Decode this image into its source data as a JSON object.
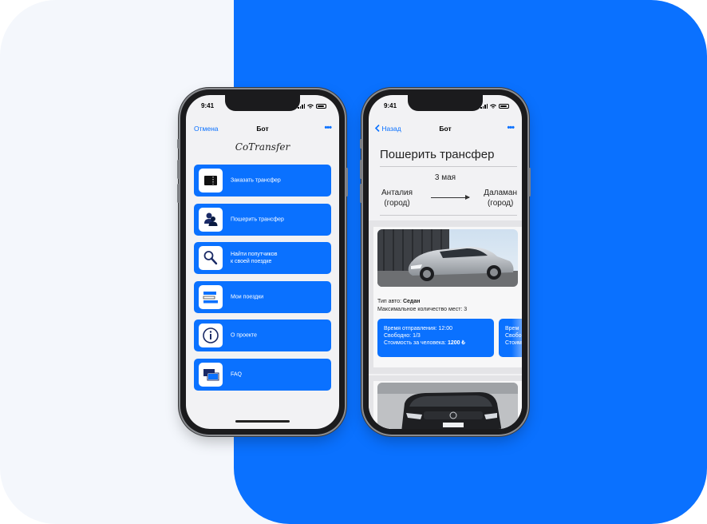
{
  "colors": {
    "accent": "#0a71ff",
    "background_left": "#f4f7fc"
  },
  "phone1": {
    "status_time": "9:41",
    "nav": {
      "left": "Отмена",
      "title": "Бот",
      "more": "•••"
    },
    "logo": "CoTransfer",
    "menu": [
      {
        "label": "Заказать трансфер",
        "icon": "ticket-icon"
      },
      {
        "label": "Пошерить трансфер",
        "icon": "people-icon"
      },
      {
        "label": "Найти попутчиков\nк своей поездке",
        "icon": "magnifier-icon"
      },
      {
        "label": "Мои поездки",
        "icon": "trips-list-icon"
      },
      {
        "label": "О проекте",
        "icon": "info-icon"
      },
      {
        "label": "FAQ",
        "icon": "chat-icon"
      }
    ]
  },
  "phone2": {
    "status_time": "9:41",
    "nav": {
      "back": "Назад",
      "title": "Бот",
      "more": "•••"
    },
    "title": "Пошерить трансфер",
    "date": "3 мая",
    "from": "Анталия\n(город)",
    "to": "Даламан\n(город)",
    "car_type_label": "Тип авто: ",
    "car_type": "Седан",
    "max_seats": "Максимальное количество мест: 3",
    "slot": {
      "departure": "Время отправления: 12:00",
      "free": "Свободно: 1/3",
      "price_label": "Стоимость за человека: ",
      "price": "1200 ₺"
    },
    "slot_partial": "Врем\nСвобо\nСтоим"
  }
}
